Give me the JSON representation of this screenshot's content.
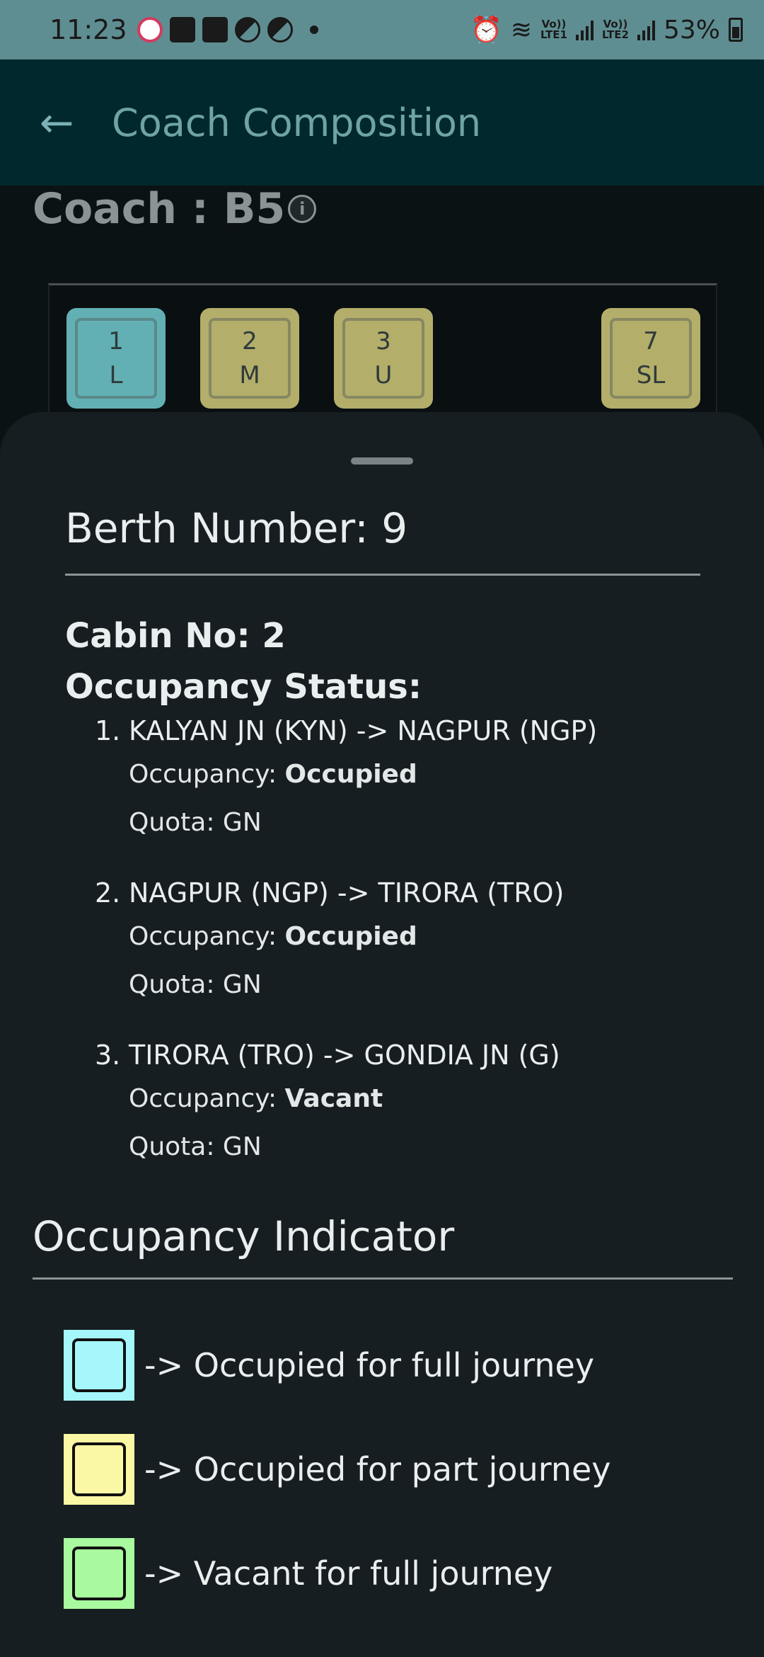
{
  "status_bar": {
    "time": "11:23",
    "network1": "Vo))\nLTE1",
    "network2": "Vo))\nLTE2",
    "battery": "53%"
  },
  "app_bar": {
    "title": "Coach Composition",
    "back_icon": "arrow-left-icon"
  },
  "coach": {
    "title": "Coach : B5",
    "berths": [
      {
        "number": "1",
        "type": "L",
        "color": "#62b0b3"
      },
      {
        "number": "2",
        "type": "M",
        "color": "#b3ae6a"
      },
      {
        "number": "3",
        "type": "U",
        "color": "#b3ae6a"
      },
      {
        "number": "7",
        "type": "SL",
        "color": "#b3ae6a"
      }
    ]
  },
  "sheet": {
    "berth_heading": "Berth Number: 9",
    "cabin": "Cabin No: 2",
    "occupancy_heading": "Occupancy Status:",
    "segments": [
      {
        "index": "1.",
        "route": "KALYAN JN (KYN) -> NAGPUR (NGP)",
        "occupancy_label": "Occupancy: ",
        "occupancy": "Occupied",
        "quota": "Quota: GN"
      },
      {
        "index": "2.",
        "route": "NAGPUR (NGP) -> TIRORA (TRO)",
        "occupancy_label": "Occupancy: ",
        "occupancy": "Occupied",
        "quota": "Quota: GN"
      },
      {
        "index": "3.",
        "route": "TIRORA (TRO) -> GONDIA JN (G)",
        "occupancy_label": "Occupancy: ",
        "occupancy": "Vacant",
        "quota": "Quota: GN"
      }
    ],
    "indicator_title": "Occupancy Indicator",
    "legend": [
      {
        "label": "-> Occupied for full journey",
        "color": "#a5f7fb"
      },
      {
        "label": "-> Occupied for part journey",
        "color": "#fbf8a5"
      },
      {
        "label": "-> Vacant for full journey",
        "color": "#a9f99e"
      }
    ]
  }
}
